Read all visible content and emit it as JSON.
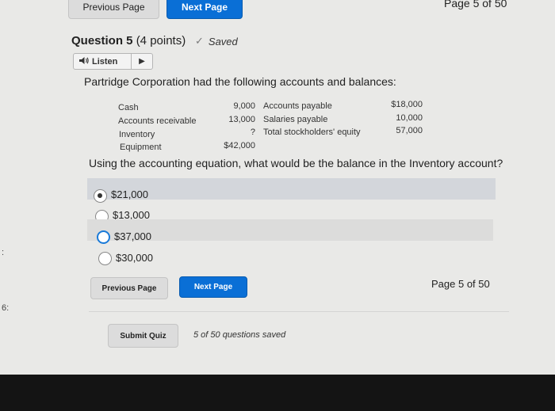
{
  "nav_top": {
    "previous_label": "Previous Page",
    "next_label": "Next Page",
    "page_indicator": "Page 5 of 50"
  },
  "question": {
    "title": "Question 5",
    "points": "(4 points)",
    "saved_label": "Saved",
    "listen_label": "Listen",
    "prompt": "Partridge Corporation had the following accounts and balances:",
    "text": "Using the accounting equation, what would be the balance in the Inventory account?"
  },
  "accounts": {
    "left": [
      {
        "name": "Cash",
        "value": "9,000"
      },
      {
        "name": "Accounts receivable",
        "value": "13,000"
      },
      {
        "name": "Inventory",
        "value": "?"
      },
      {
        "name": "Equipment",
        "value": "$42,000"
      }
    ],
    "right": [
      {
        "name": "Accounts payable",
        "value": "$18,000"
      },
      {
        "name": "Salaries payable",
        "value": "10,000"
      },
      {
        "name": "Total stockholders' equity",
        "value": "57,000"
      }
    ]
  },
  "options": [
    {
      "label": "$21,000",
      "selected": true
    },
    {
      "label": "$13,000",
      "selected": false
    },
    {
      "label": "$37,000",
      "selected": false
    },
    {
      "label": "$30,000",
      "selected": false
    }
  ],
  "nav_bottom": {
    "previous_label": "Previous Page",
    "next_label": "Next Page",
    "page_indicator": "Page 5 of 50"
  },
  "submit": {
    "submit_label": "Submit Quiz",
    "saved_count": "5 of 50 questions saved"
  },
  "left_marks": [
    ":",
    "6:"
  ],
  "colors": {
    "primary": "#0a6fd6",
    "background": "#e9e9e7",
    "selected_option_bg": "#d3d6db"
  }
}
